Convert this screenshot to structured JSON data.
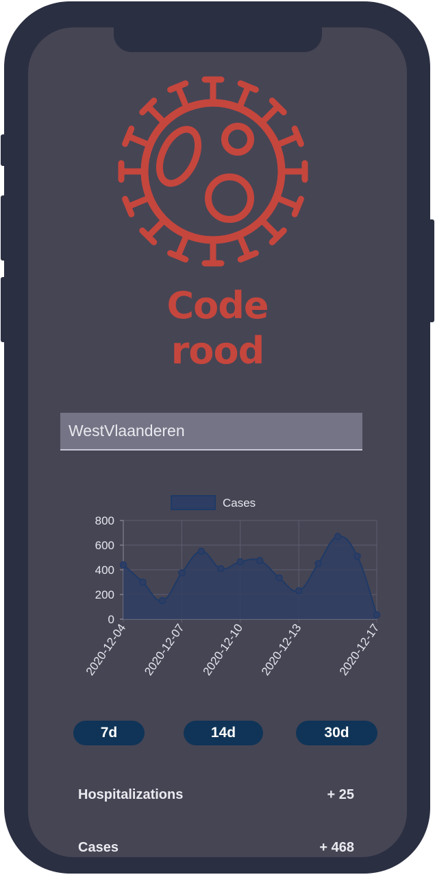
{
  "header": {
    "title_line1": "Code",
    "title_line2": "rood",
    "brand_color": "#c5463d",
    "icon": "virus-icon"
  },
  "region_input": {
    "value": "WestVlaanderen",
    "placeholder": ""
  },
  "chart_data": {
    "type": "line",
    "legend": [
      "Cases"
    ],
    "legend_position": "top",
    "series": [
      {
        "name": "Cases",
        "color": "#1f3a66",
        "x": [
          "2020-12-04",
          "2020-12-05",
          "2020-12-06",
          "2020-12-07",
          "2020-12-08",
          "2020-12-09",
          "2020-12-10",
          "2020-12-11",
          "2020-12-12",
          "2020-12-13",
          "2020-12-14",
          "2020-12-15",
          "2020-12-16",
          "2020-12-17"
        ],
        "values": [
          440,
          300,
          150,
          375,
          550,
          410,
          465,
          475,
          335,
          230,
          450,
          670,
          510,
          35
        ]
      }
    ],
    "x_tick_labels": [
      "2020-12-04",
      "2020-12-07",
      "2020-12-10",
      "2020-12-13",
      "2020-12-17"
    ],
    "y_ticks": [
      "0",
      "200",
      "400",
      "600",
      "800"
    ],
    "ylim": [
      0,
      800
    ],
    "grid": true,
    "fill": true
  },
  "range_buttons": [
    {
      "label": "7d"
    },
    {
      "label": "14d"
    },
    {
      "label": "30d"
    }
  ],
  "stats": [
    {
      "label": "Hospitalizations",
      "value": "+ 25"
    },
    {
      "label": "Cases",
      "value": "+ 468"
    }
  ]
}
